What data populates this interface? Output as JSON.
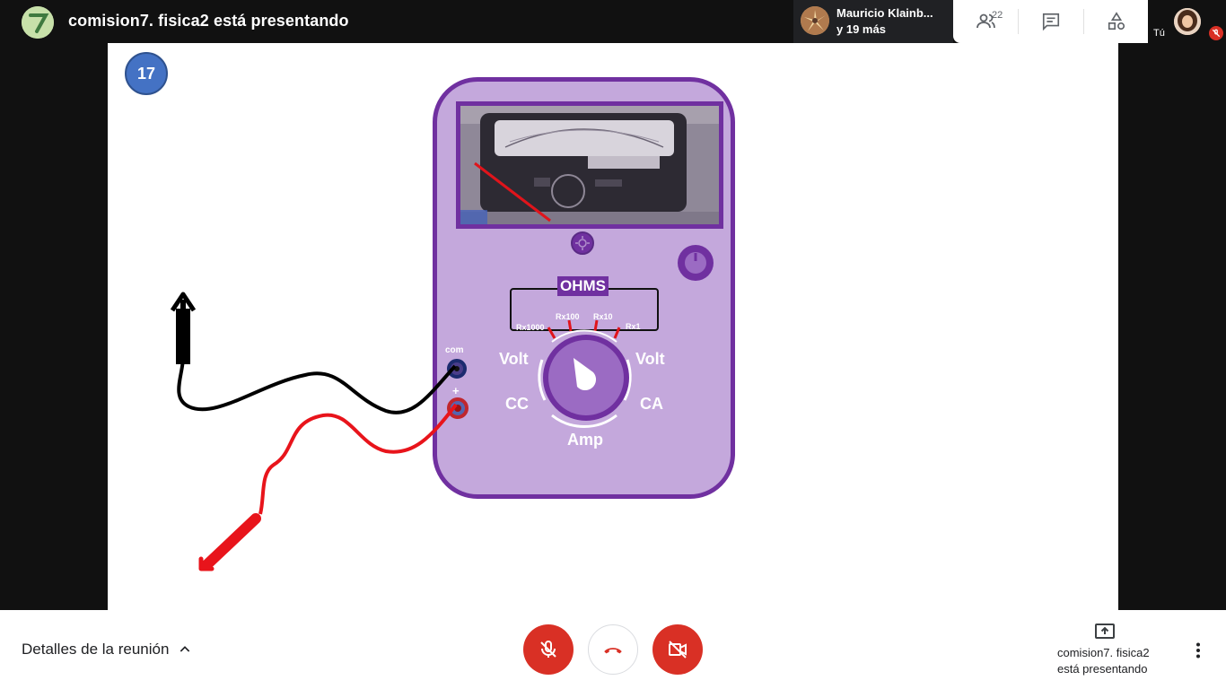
{
  "header": {
    "meeting_title": "comision7. fisica2 está presentando",
    "presenter_name": "Mauricio Klainb...",
    "presenter_more": "y 19 más",
    "people_count": "22",
    "self_label": "Tú"
  },
  "slide": {
    "number": "17",
    "ohms_label": "OHMS",
    "ranges": [
      "Rx1000",
      "Rx100",
      "Rx10",
      "Rx1"
    ],
    "volt_left": "Volt",
    "volt_right": "Volt",
    "cc_label": "CC",
    "ca_label": "CA",
    "amp_label": "Amp",
    "com_label": "com",
    "plus_label": "+"
  },
  "footer": {
    "details_label": "Detalles de la reunión",
    "presenting_line1": "comision7. fisica2",
    "presenting_line2": "está presentando"
  },
  "colors": {
    "accent_red": "#d93025",
    "meter_purple": "#7030a0",
    "meter_body": "#c4a8dc",
    "slide_badge": "#4472c4"
  },
  "icons": [
    "people-icon",
    "chat-icon",
    "activities-icon",
    "mic-off-icon",
    "hangup-icon",
    "camera-off-icon",
    "present-icon",
    "more-vert-icon",
    "chevron-up-icon"
  ]
}
